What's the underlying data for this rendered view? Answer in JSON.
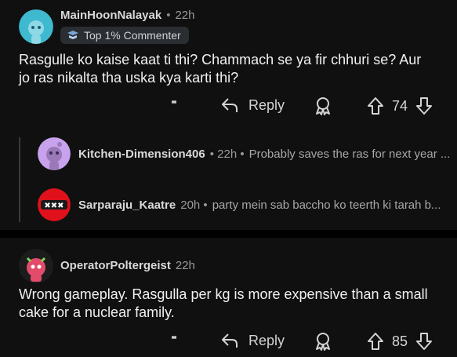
{
  "comments": [
    {
      "username": "MainHoonNalayak",
      "time": "22h",
      "flair": "Top 1% Commenter",
      "body": "Rasgulle ko kaise kaat ti thi? Chammach se ya fir chhuri se? Aur jo ras nikalta tha uska kya karti thi?",
      "reply_label": "Reply",
      "score": "74",
      "avatar_color": "#3fb9cf"
    },
    {
      "username": "OperatorPoltergeist",
      "time": "22h",
      "body": "Wrong gameplay. Rasgulla per kg is more expensive than a small cake for a nuclear family.",
      "reply_label": "Reply",
      "score": "85",
      "avatar_color": "#e24b6a"
    }
  ],
  "replies": [
    {
      "username": "Kitchen-Dimension406",
      "time": "• 22h •",
      "snippet": "Probably saves the ras for next year ...",
      "avatar_color": "#c9a2ee"
    },
    {
      "username": "Sarparaju_Kaatre",
      "time": "20h •",
      "snippet": "party mein sab baccho ko teerth ki tarah b...",
      "avatar_color": "#e0111a"
    }
  ],
  "icons": {
    "kebab": "more-options-icon",
    "reply": "reply-arrow-icon",
    "award": "award-icon",
    "upvote": "upvote-icon",
    "downvote": "downvote-icon"
  }
}
